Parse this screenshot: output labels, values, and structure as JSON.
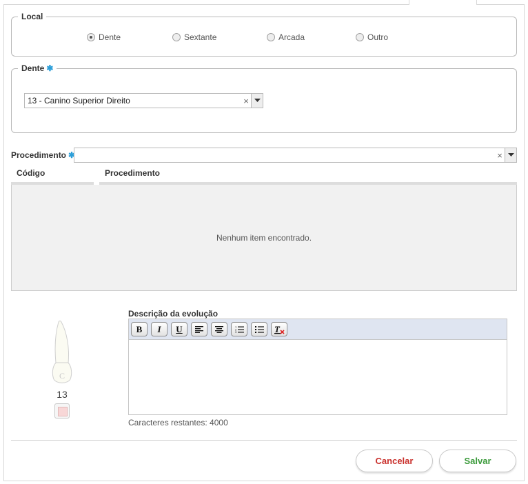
{
  "local": {
    "legend": "Local",
    "options": [
      {
        "label": "Dente",
        "selected": true
      },
      {
        "label": "Sextante",
        "selected": false
      },
      {
        "label": "Arcada",
        "selected": false
      },
      {
        "label": "Outro",
        "selected": false
      }
    ]
  },
  "dente": {
    "legend": "Dente",
    "required_mark": "✱",
    "selected_value": "13 - Canino Superior Direito",
    "clear_glyph": "×"
  },
  "procedimento": {
    "label": "Procedimento",
    "required_mark": "✱",
    "value": "",
    "clear_glyph": "×"
  },
  "table": {
    "columns": [
      "Código",
      "Procedimento"
    ],
    "empty_message": "Nenhum item encontrado."
  },
  "tooth": {
    "number": "13",
    "crown_letter": "C"
  },
  "editor": {
    "label": "Descrição da evolução",
    "content": "",
    "chars_remaining": "Caracteres restantes: 4000",
    "toolbar": [
      "bold-icon",
      "italic-icon",
      "underline-icon",
      "align-left-icon",
      "align-center-icon",
      "ordered-list-icon",
      "unordered-list-icon",
      "remove-format-icon"
    ]
  },
  "actions": {
    "cancel_label": "Cancelar",
    "save_label": "Salvar"
  },
  "colors": {
    "cancel": "#c9302c",
    "save": "#3a9a3a",
    "required": "#2c9fd9",
    "toolbar_bg": "#dfe5f1"
  }
}
